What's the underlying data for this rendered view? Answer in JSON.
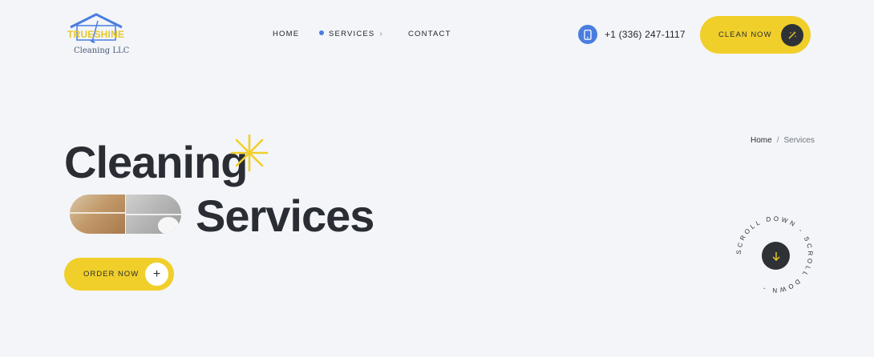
{
  "logo": {
    "word1": "TRUE",
    "word2": "SHINE",
    "subtitle": "Cleaning LLC"
  },
  "nav": {
    "home": "HOME",
    "services": "SERVICES",
    "contact": "CONTACT",
    "active": "services"
  },
  "header": {
    "phone": "+1 (336) 247-1117",
    "cta_label": "CLEAN NOW"
  },
  "breadcrumb": {
    "home": "Home",
    "separator": "/",
    "current": "Services"
  },
  "hero": {
    "title_line1": "Cleaning",
    "title_line2": "Services",
    "order_label": "ORDER NOW",
    "order_icon": "+"
  },
  "scroll": {
    "text": "SCROLL DOWN - SCROLL DOWN - "
  },
  "colors": {
    "background": "#f3f5f8",
    "accent_yellow": "#f0cf2a",
    "accent_blue": "#4a7de0",
    "dark": "#2e3237"
  },
  "icons": {
    "phone": "phone-icon",
    "cta": "magic-wand-icon",
    "scroll": "arrow-down-icon",
    "sparkle": "sparkle-icon",
    "chevron": "chevron-right-icon"
  }
}
